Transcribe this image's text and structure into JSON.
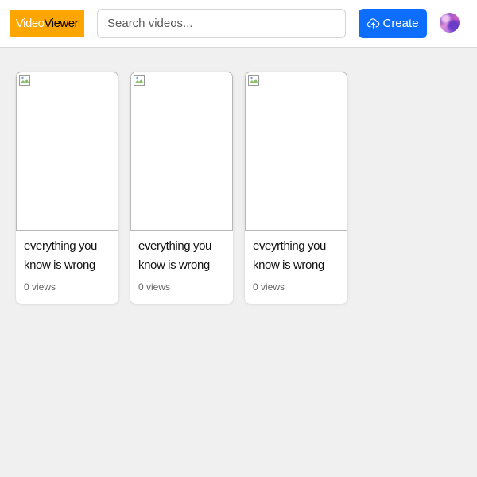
{
  "header": {
    "logo_part1": "Video",
    "logo_part2": "Viewer",
    "search_placeholder": "Search videos...",
    "create_label": "Create",
    "create_icon": "cloud-upload-icon",
    "avatar_icon": "user-avatar"
  },
  "colors": {
    "logo_bg": "#ffa500",
    "create_bg": "#0d6efd",
    "page_bg": "#f0f0f0"
  },
  "videos": [
    {
      "title": "everything you know is wrong",
      "views": "0 views"
    },
    {
      "title": "everything you know is wrong",
      "views": "0 views"
    },
    {
      "title": "eveyrthing you know is wrong",
      "views": "0 views"
    }
  ]
}
